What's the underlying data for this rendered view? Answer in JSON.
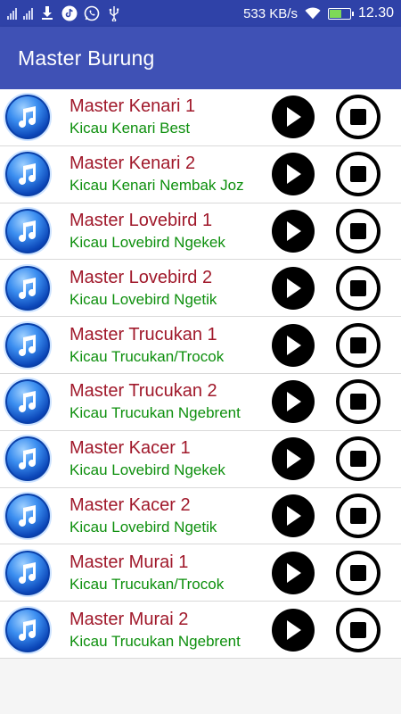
{
  "status_bar": {
    "net_speed": "533 KB/s",
    "time": "12.30",
    "icons": [
      "signal-icon",
      "signal-icon",
      "download-icon",
      "tiktok-icon",
      "whatsapp-icon",
      "usb-icon",
      "wifi-icon",
      "battery-icon"
    ]
  },
  "appbar": {
    "title": "Master Burung"
  },
  "colors": {
    "appbar": "#3f51b5",
    "statusbar": "#2f42a8",
    "title_text": "#a0182a",
    "subtitle_text": "#0d8f0d"
  },
  "items": [
    {
      "title": "Master Kenari 1",
      "subtitle": "Kicau Kenari Best"
    },
    {
      "title": "Master Kenari 2",
      "subtitle": "Kicau Kenari Nembak Joz"
    },
    {
      "title": "Master Lovebird 1",
      "subtitle": "Kicau Lovebird Ngekek"
    },
    {
      "title": "Master Lovebird 2",
      "subtitle": "Kicau Lovebird Ngetik"
    },
    {
      "title": "Master Trucukan 1",
      "subtitle": "Kicau Trucukan/Trocok"
    },
    {
      "title": "Master Trucukan 2",
      "subtitle": "Kicau Trucukan Ngebrent"
    },
    {
      "title": "Master Kacer 1",
      "subtitle": "Kicau Lovebird Ngekek"
    },
    {
      "title": "Master Kacer 2",
      "subtitle": "Kicau Lovebird Ngetik"
    },
    {
      "title": "Master Murai 1",
      "subtitle": "Kicau Trucukan/Trocok"
    },
    {
      "title": "Master Murai 2",
      "subtitle": "Kicau Trucukan Ngebrent"
    }
  ]
}
